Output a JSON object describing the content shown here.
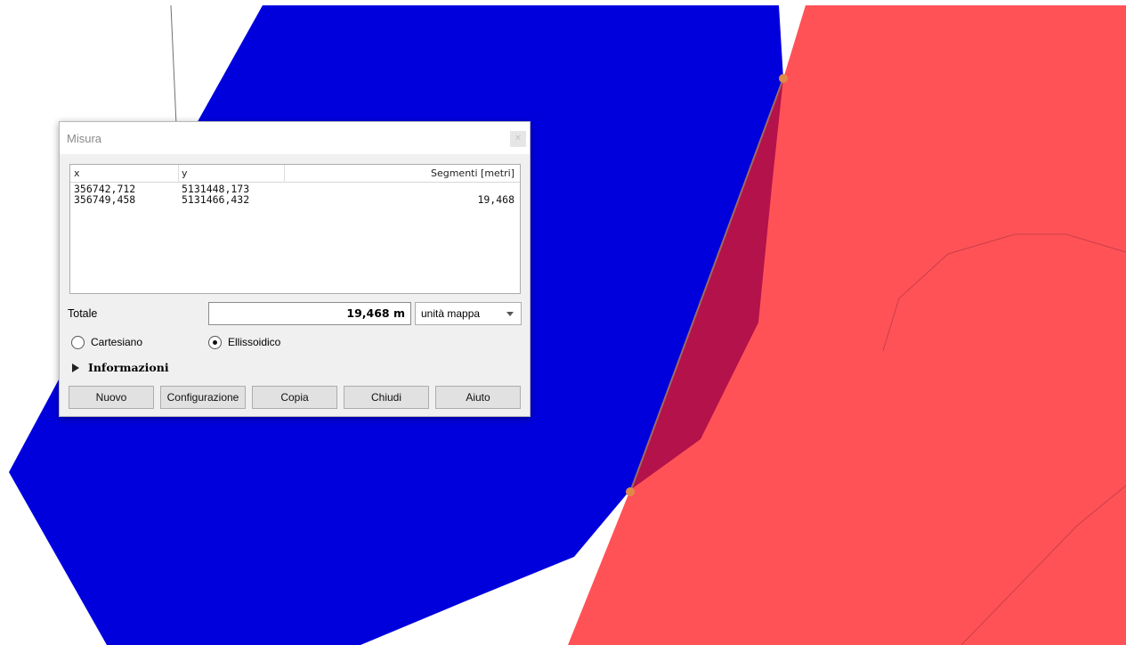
{
  "map": {
    "colors": {
      "blue_polygon": "#0000dd",
      "red_polygon": "#ff5257",
      "overlap": "#b3124a",
      "vertex": "#e08a4a",
      "guide_line": "#707070"
    }
  },
  "dialog": {
    "title": "Misura",
    "close_icon": "close-icon",
    "table": {
      "headers": [
        "x",
        "y",
        "",
        "Segmenti [metri]"
      ],
      "rows": [
        {
          "x": "356742,712",
          "y": "5131448,173",
          "segment": ""
        },
        {
          "x": "356749,458",
          "y": "5131466,432",
          "segment": "19,468"
        }
      ]
    },
    "total_label": "Totale",
    "total_value": "19,468 m",
    "units_selected": "unità mappa",
    "radio_cartesian": "Cartesiano",
    "radio_ellipsoidal": "Ellissoidico",
    "selected_mode": "ellipsoidal",
    "info_label": "Informazioni",
    "buttons": {
      "nuovo": "Nuovo",
      "configurazione": "Configurazione",
      "copia": "Copia",
      "chiudi": "Chiudi",
      "aiuto": "Aiuto"
    }
  }
}
